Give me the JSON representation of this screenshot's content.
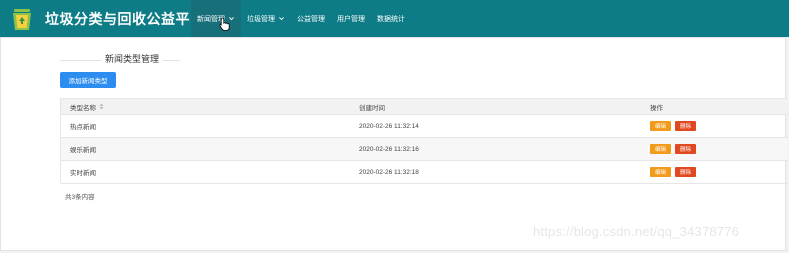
{
  "app": {
    "title": "垃圾分类与回收公益平台"
  },
  "nav": {
    "items": [
      {
        "label": "新闻管理",
        "has_dropdown": true,
        "active": true
      },
      {
        "label": "垃圾管理",
        "has_dropdown": true,
        "active": false
      },
      {
        "label": "公益管理",
        "has_dropdown": false,
        "active": false
      },
      {
        "label": "用户管理",
        "has_dropdown": false,
        "active": false
      },
      {
        "label": "数据统计",
        "has_dropdown": false,
        "active": false
      }
    ]
  },
  "page": {
    "title": "新闻类型管理",
    "add_button_label": "添加新闻类型"
  },
  "table": {
    "headers": {
      "name": "类型名称",
      "created": "创建时间",
      "ops": "操作"
    },
    "rows": [
      {
        "name": "热点新闻",
        "created": "2020-02-26 11:32:14",
        "edit": "编辑",
        "delete": "删除"
      },
      {
        "name": "娱乐新闻",
        "created": "2020-02-26 11:32:16",
        "edit": "编辑",
        "delete": "删除"
      },
      {
        "name": "实时新闻",
        "created": "2020-02-26 11:32:18",
        "edit": "编辑",
        "delete": "删除"
      }
    ]
  },
  "pagination": {
    "total_text": "共3条内容"
  },
  "watermark": "https://blog.csdn.net/qq_34378776",
  "colors": {
    "topbar": "#0e7c86",
    "nav_active": "#176f79",
    "primary_button": "#2d8cf0",
    "edit_button": "#f29a1a",
    "delete_button": "#e0481f"
  },
  "icons": {
    "logo": "recycle-bin-icon",
    "dropdown": "chevron-down-icon",
    "sort": "sort-icon",
    "cursor": "hand-cursor-icon"
  }
}
